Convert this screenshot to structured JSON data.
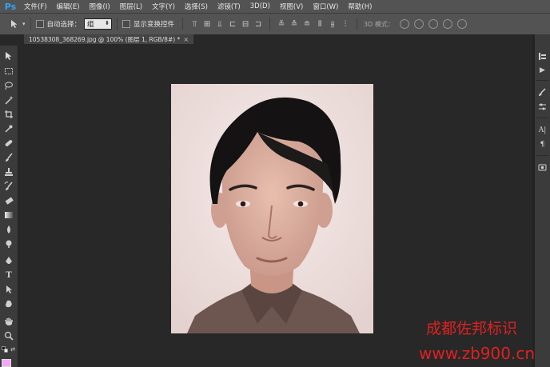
{
  "app": {
    "logo": "Ps"
  },
  "menu": [
    "文件(F)",
    "编辑(E)",
    "图像(I)",
    "图层(L)",
    "文字(Y)",
    "选择(S)",
    "滤镜(T)",
    "3D(D)",
    "视图(V)",
    "窗口(W)",
    "帮助(H)"
  ],
  "options": {
    "move_icon": "move-tool-icon",
    "auto_select_label": "自动选择：",
    "auto_select_value": "组",
    "show_transform_label": "显示变换控件",
    "mode3d_label": "3D 模式："
  },
  "document_tab": {
    "title": "10538308_368269.jpg @ 100% (图层 1, RGB/8#) *",
    "close": "×"
  },
  "tools": [
    "move-tool-icon",
    "marquee-tool-icon",
    "lasso-tool-icon",
    "magic-wand-icon",
    "crop-tool-icon",
    "eyedropper-icon",
    "healing-brush-icon",
    "brush-tool-icon",
    "clone-stamp-icon",
    "history-brush-icon",
    "eraser-icon",
    "gradient-tool-icon",
    "blur-tool-icon",
    "dodge-tool-icon",
    "pen-tool-icon",
    "type-tool-icon",
    "path-selection-icon",
    "shape-tool-icon",
    "hand-tool-icon",
    "zoom-tool-icon"
  ],
  "colors": {
    "foreground": "#f6a7f3",
    "canvas_bg": "#efe2e0",
    "watermark": "#e02020"
  },
  "watermark": {
    "line1": "成都佐邦标识",
    "line2": "www.zb900.cn"
  }
}
